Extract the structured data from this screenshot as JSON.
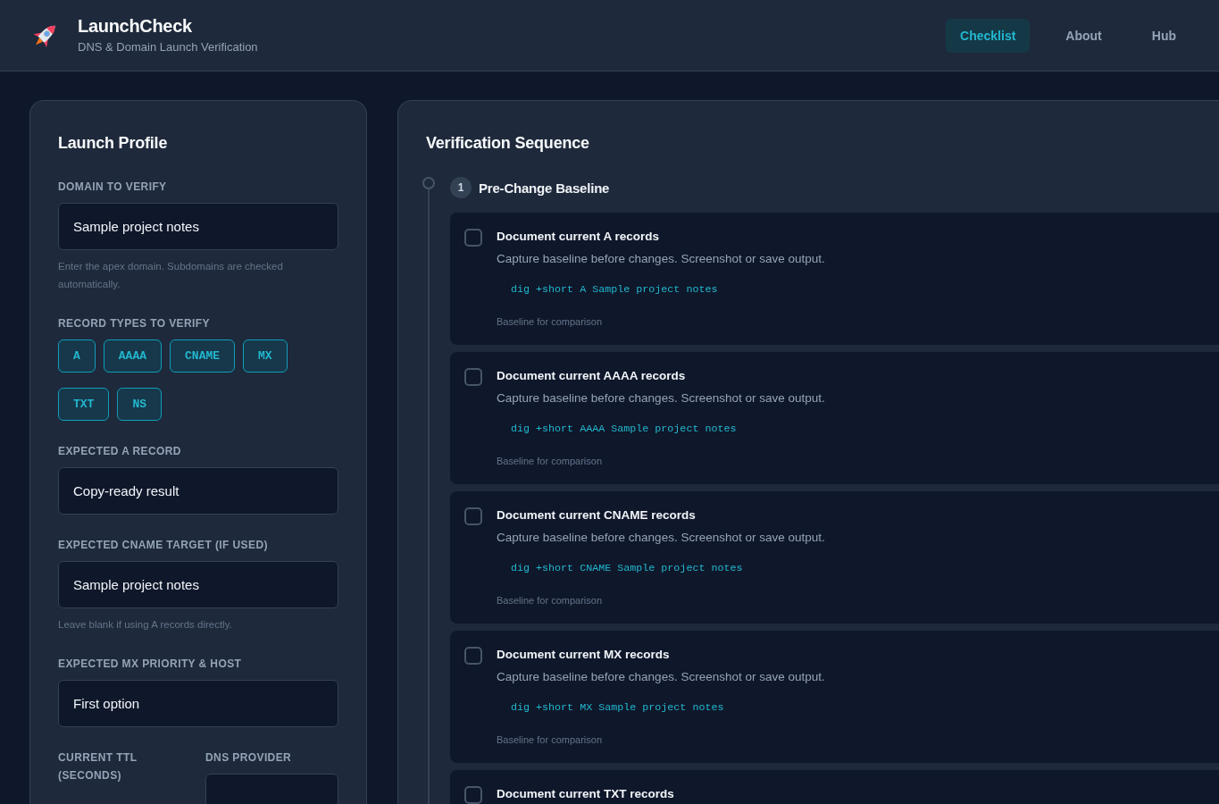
{
  "header": {
    "title": "LaunchCheck",
    "subtitle": "DNS & Domain Launch Verification"
  },
  "nav": [
    {
      "label": "Checklist",
      "selected": true
    },
    {
      "label": "About",
      "selected": false
    },
    {
      "label": "Hub",
      "selected": false
    }
  ],
  "profile": {
    "title": "Launch Profile",
    "fields": [
      {
        "kind": "input",
        "label": "DOMAIN TO VERIFY",
        "value": "Sample project notes",
        "help": "Enter the apex domain. Subdomains are checked automatically."
      },
      {
        "kind": "chips",
        "label": "RECORD TYPES TO VERIFY",
        "options": [
          {
            "label": "A",
            "selected": true
          },
          {
            "label": "AAAA",
            "selected": true
          },
          {
            "label": "CNAME",
            "selected": true
          },
          {
            "label": "MX",
            "selected": true
          },
          {
            "label": "TXT",
            "selected": true
          },
          {
            "label": "NS",
            "selected": true
          }
        ]
      },
      {
        "kind": "input",
        "label": "EXPECTED A RECORD",
        "value": "Copy-ready result"
      },
      {
        "kind": "input",
        "label": "EXPECTED CNAME TARGET (IF USED)",
        "value": "Sample project notes",
        "help": "Leave blank if using A records directly."
      },
      {
        "kind": "input",
        "label": "EXPECTED MX PRIORITY & HOST",
        "value": "First option"
      },
      {
        "kind": "columns",
        "columns": [
          {
            "kind": "label",
            "label": "CURRENT TTL (SECONDS)"
          },
          {
            "kind": "input",
            "label": "DNS PROVIDER"
          }
        ]
      }
    ]
  },
  "sequence": {
    "title": "Verification Sequence",
    "steps": [
      {
        "number": "1",
        "title": "Pre-Change Baseline",
        "tasks": [
          {
            "title": "Document current A records",
            "checked": false,
            "description": "Capture baseline before changes. Screenshot or save output.",
            "command": "dig +short A Sample project notes",
            "note": "Baseline for comparison"
          },
          {
            "title": "Document current AAAA records",
            "checked": false,
            "description": "Capture baseline before changes. Screenshot or save output.",
            "command": "dig +short AAAA Sample project notes",
            "note": "Baseline for comparison"
          },
          {
            "title": "Document current CNAME records",
            "checked": false,
            "description": "Capture baseline before changes. Screenshot or save output.",
            "command": "dig +short CNAME Sample project notes",
            "note": "Baseline for comparison"
          },
          {
            "title": "Document current MX records",
            "checked": false,
            "description": "Capture baseline before changes. Screenshot or save output.",
            "command": "dig +short MX Sample project notes",
            "note": "Baseline for comparison"
          },
          {
            "title": "Document current TXT records",
            "checked": false
          }
        ]
      }
    ]
  }
}
